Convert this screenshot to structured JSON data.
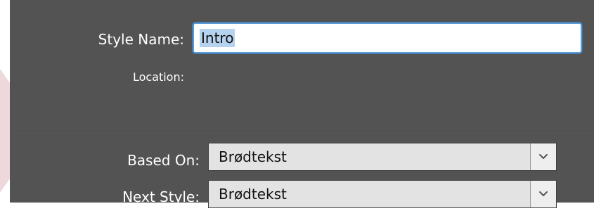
{
  "form": {
    "style_name_label": "Style Name:",
    "style_name_value": "Intro",
    "location_label": "Location:",
    "location_value": "",
    "based_on_label": "Based On:",
    "based_on_value": "Brødtekst",
    "next_style_label": "Next Style:",
    "next_style_value": "Brødtekst"
  },
  "icons": {
    "dropdown": "chevron-down-icon"
  },
  "colors": {
    "panel_background": "#535353",
    "focus_ring": "#5b9bd8",
    "text_selection": "#b5d2ee",
    "dropdown_background": "#e3e3e3"
  }
}
